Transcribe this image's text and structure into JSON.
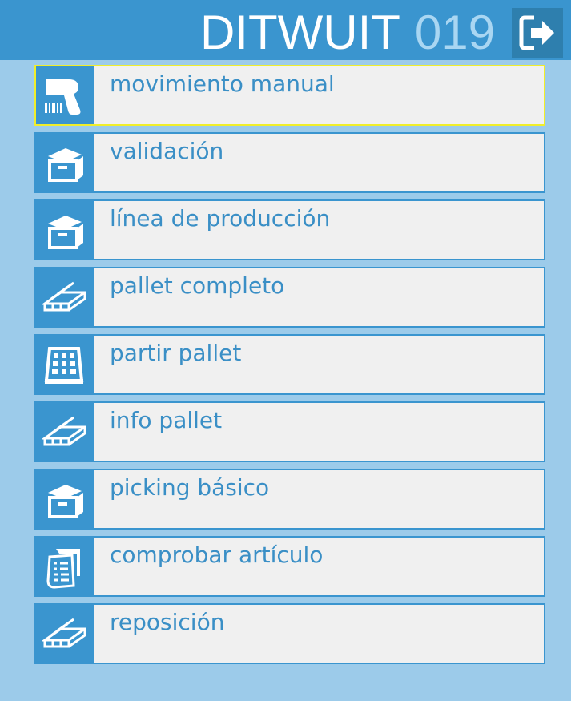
{
  "header": {
    "brand": "DITWUIT",
    "number": "019",
    "exit_icon": "exit-icon"
  },
  "colors": {
    "header_bg": "#3a95cf",
    "page_bg": "#9ccbea",
    "item_bg": "#f0f0f0",
    "label_text": "#3a8fc6",
    "selected_border": "#f0ee2a"
  },
  "menu": {
    "items": [
      {
        "label": "movimiento manual",
        "icon": "barcode-scanner-icon",
        "selected": true
      },
      {
        "label": "validación",
        "icon": "box-icon"
      },
      {
        "label": "línea de producción",
        "icon": "box-icon"
      },
      {
        "label": "pallet completo",
        "icon": "pallet-icon"
      },
      {
        "label": "partir pallet",
        "icon": "grid-icon"
      },
      {
        "label": "info pallet",
        "icon": "pallet-icon"
      },
      {
        "label": "picking básico",
        "icon": "box-icon"
      },
      {
        "label": "comprobar artículo",
        "icon": "receipt-icon"
      },
      {
        "label": "reposición",
        "icon": "pallet-icon"
      }
    ]
  }
}
